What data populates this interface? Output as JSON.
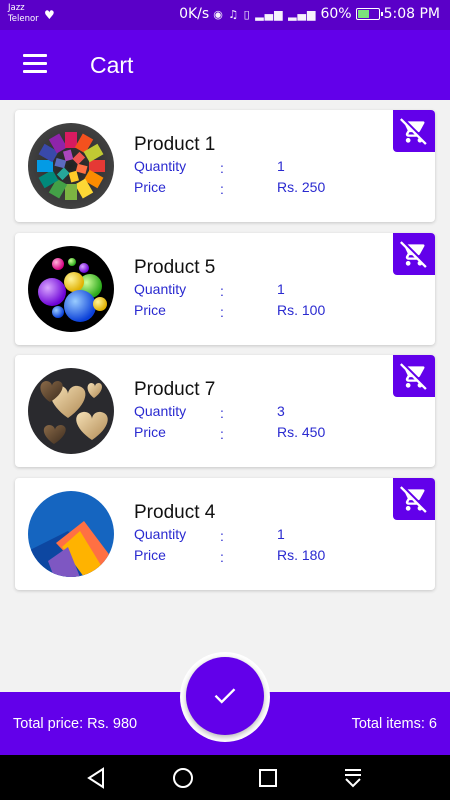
{
  "status_bar": {
    "carrier_line1": "Jazz",
    "carrier_line2": "Telenor",
    "speed": "0K/s",
    "battery_percent": "60%",
    "battery_level": 0.6,
    "time": "5:08 PM"
  },
  "app_bar": {
    "title": "Cart",
    "menu_icon": "hamburger-menu-icon"
  },
  "labels": {
    "quantity": "Quantity",
    "price": "Price",
    "separator": ":"
  },
  "items": [
    {
      "name": "Product 1",
      "quantity": "1",
      "price": "Rs. 250",
      "image": "color-swatch-wheel"
    },
    {
      "name": "Product 5",
      "quantity": "1",
      "price": "Rs. 100",
      "image": "glossy-balls"
    },
    {
      "name": "Product 7",
      "quantity": "3",
      "price": "Rs. 450",
      "image": "heart-shapes"
    },
    {
      "name": "Product 4",
      "quantity": "1",
      "price": "Rs. 180",
      "image": "material-shapes"
    }
  ],
  "footer": {
    "total_price": "Total price: Rs. 980",
    "total_items": "Total items: 6",
    "checkout_icon": "checkmark-icon"
  },
  "colors": {
    "primary": "#6200ea",
    "status_bar": "#5a00c8",
    "label_text": "#2a2ad0"
  }
}
